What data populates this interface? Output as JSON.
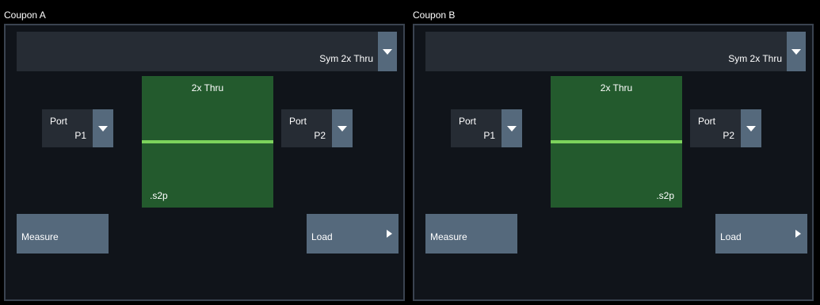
{
  "coupons": [
    {
      "title": "Coupon A",
      "fixture_type": "Sym 2x Thru",
      "port_left": {
        "label": "Port",
        "value": "P1"
      },
      "port_right": {
        "label": "Port",
        "value": "P2"
      },
      "thru": {
        "title": "2x Thru",
        "file_ext": ".s2p",
        "file_ext_align": "left"
      },
      "measure_label": "Measure",
      "load_label": "Load"
    },
    {
      "title": "Coupon B",
      "fixture_type": "Sym 2x Thru",
      "port_left": {
        "label": "Port",
        "value": "P1"
      },
      "port_right": {
        "label": "Port",
        "value": "P2"
      },
      "thru": {
        "title": "2x Thru",
        "file_ext": ".s2p",
        "file_ext_align": "right"
      },
      "measure_label": "Measure",
      "load_label": "Load"
    }
  ],
  "icons": {
    "dropdown": "chevron-down-icon",
    "load_arrow": "play-arrow-icon"
  },
  "colors": {
    "background": "#000000",
    "panel": "#10141a",
    "panel_border": "#3a4350",
    "field": "#262c34",
    "button": "#55697c",
    "thru_fill": "#235a2d",
    "thru_line": "#7cd35c",
    "text": "#ffffff"
  }
}
